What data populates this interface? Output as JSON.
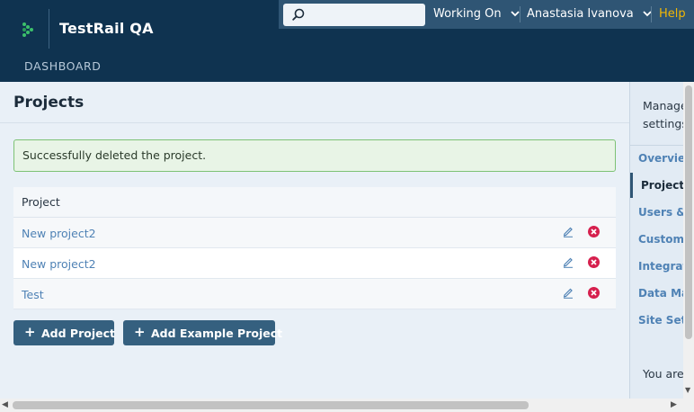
{
  "header": {
    "app_title": "TestRail QA",
    "nav_dashboard": "DASHBOARD",
    "search_placeholder": "",
    "working_on": "Working On",
    "user_name": "Anastasia Ivanova",
    "help": "Help"
  },
  "main": {
    "page_title": "Projects",
    "alert_message": "Successfully deleted the project.",
    "table_header": "Project",
    "projects": [
      {
        "name": "New project2"
      },
      {
        "name": "New project2"
      },
      {
        "name": "Test"
      }
    ],
    "add_project_label": "Add Project",
    "add_example_project_label": "Add Example Project"
  },
  "sidebar": {
    "intro_line1": "Manage",
    "intro_line2": "settings",
    "items": [
      {
        "label": "Overview"
      },
      {
        "label": "Projects"
      },
      {
        "label": "Users & Roles"
      },
      {
        "label": "Customizations"
      },
      {
        "label": "Integration"
      },
      {
        "label": "Data Management"
      },
      {
        "label": "Site Settings"
      }
    ],
    "footer_text": "You are"
  },
  "colors": {
    "header_bg": "#0f3350",
    "topbar_bg": "#2f5574",
    "accent_link": "#4f82b5",
    "success_border": "#7dc275",
    "delete_red": "#d6204e",
    "button_bg": "#35607f"
  }
}
